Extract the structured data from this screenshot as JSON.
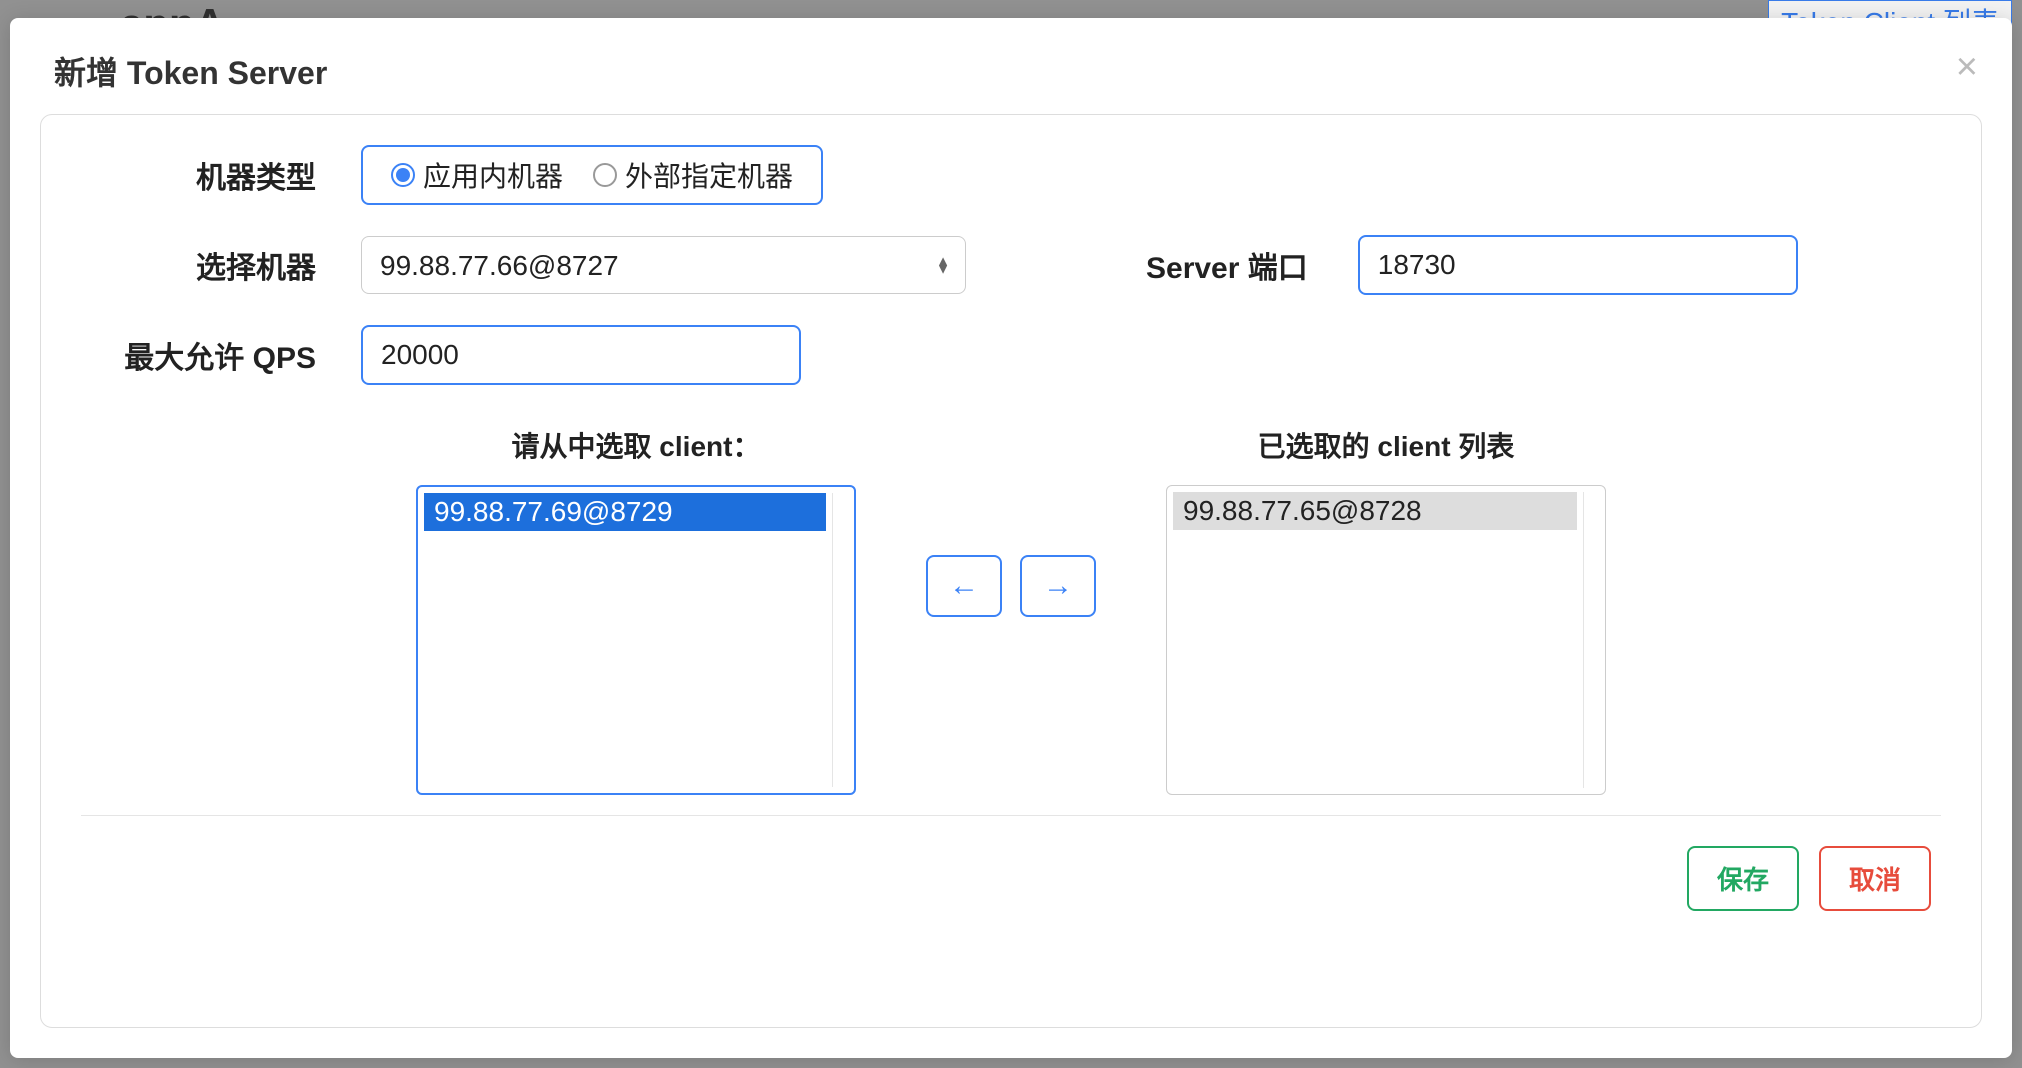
{
  "background": {
    "app_hint": "appA",
    "client_list_label": "Token Client 列表"
  },
  "modal": {
    "title": "新增 Token Server",
    "labels": {
      "machine_type": "机器类型",
      "select_machine": "选择机器",
      "server_port": "Server 端口",
      "max_qps": "最大允许 QPS"
    },
    "machine_type": {
      "option_internal": "应用内机器",
      "option_external": "外部指定机器",
      "selected": "internal"
    },
    "select_machine": {
      "value": "99.88.77.66@8727"
    },
    "server_port": {
      "value": "18730"
    },
    "max_qps": {
      "value": "20000"
    },
    "transfer": {
      "available_title": "请从中选取 client：",
      "selected_title": "已选取的 client 列表",
      "available_items": [
        "99.88.77.69@8729"
      ],
      "selected_items": [
        "99.88.77.65@8728"
      ]
    },
    "footer": {
      "save": "保存",
      "cancel": "取消"
    }
  }
}
